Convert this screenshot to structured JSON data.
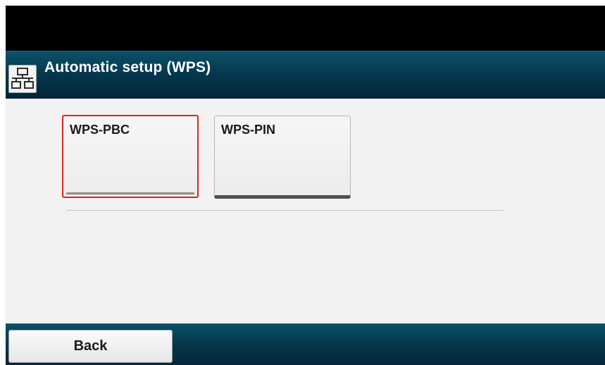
{
  "header": {
    "title": "Automatic setup (WPS)",
    "icon": "network-icon"
  },
  "options": [
    {
      "label": "WPS-PBC",
      "selected": true
    },
    {
      "label": "WPS-PIN",
      "selected": false
    }
  ],
  "footer": {
    "back_label": "Back"
  },
  "colors": {
    "header_bar": "#05344a",
    "content_bg": "#f2f2f2",
    "selection_outline": "#e0241f"
  }
}
